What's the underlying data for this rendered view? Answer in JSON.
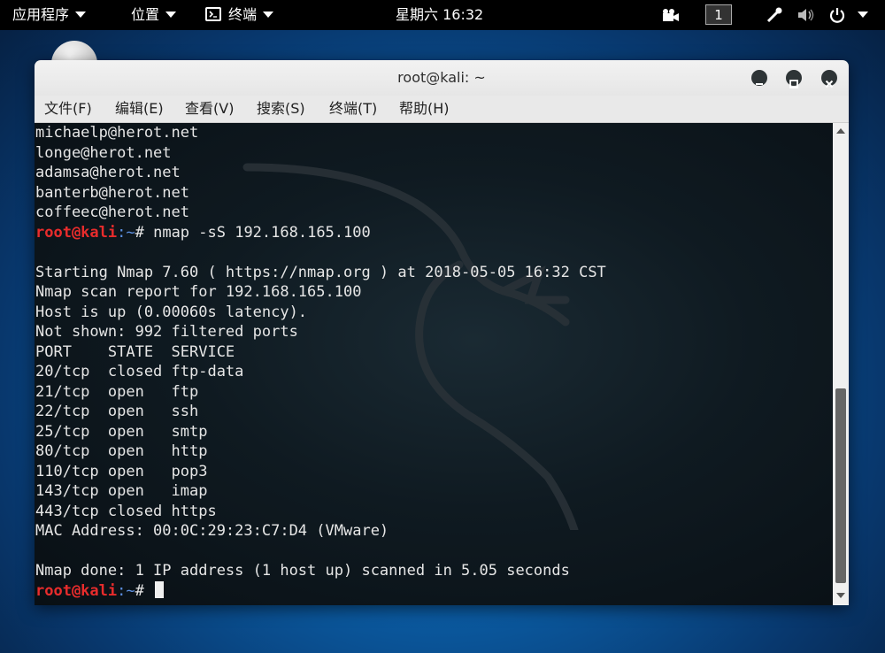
{
  "topbar": {
    "applications": "应用程序",
    "places": "位置",
    "terminal_app": "终端",
    "clock": "星期六 16:32",
    "workspace": "1"
  },
  "window": {
    "title": "root@kali: ~"
  },
  "menubar": {
    "items": [
      "文件(F)",
      "编辑(E)",
      "查看(V)",
      "搜索(S)",
      "终端(T)",
      "帮助(H)"
    ]
  },
  "terminal": {
    "prompt_user": "root@kali",
    "prompt_path": ":~",
    "prompt_symbol": "# ",
    "lines": [
      "michaelp@herot.net",
      "longe@herot.net",
      "adamsa@herot.net",
      "banterb@herot.net",
      "coffeec@herot.net",
      "",
      "",
      "Starting Nmap 7.60 ( https://nmap.org ) at 2018-05-05 16:32 CST",
      "Nmap scan report for 192.168.165.100",
      "Host is up (0.00060s latency).",
      "Not shown: 992 filtered ports",
      "PORT    STATE  SERVICE",
      "20/tcp  closed ftp-data",
      "21/tcp  open   ftp",
      "22/tcp  open   ssh",
      "25/tcp  open   smtp",
      "80/tcp  open   http",
      "110/tcp open   pop3",
      "143/tcp open   imap",
      "443/tcp closed https",
      "MAC Address: 00:0C:29:23:C7:D4 (VMware)",
      "",
      "Nmap done: 1 IP address (1 host up) scanned in 5.05 seconds"
    ],
    "command": "nmap -sS 192.168.165.100"
  },
  "colors": {
    "prompt_user": "#e82c2c",
    "prompt_path": "#5c8fe0",
    "terminal_text": "#e6e6e6"
  }
}
